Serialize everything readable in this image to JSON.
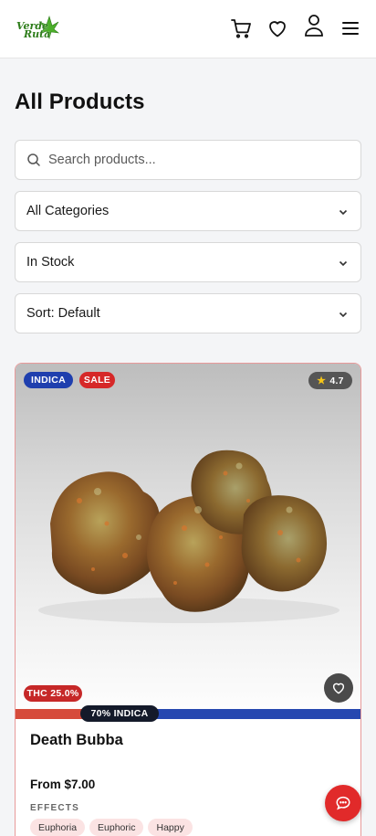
{
  "header": {
    "logo_text_line1": "Verde",
    "logo_text_line2": "Ruta",
    "icons": [
      "cart-icon",
      "heart-icon",
      "user-icon",
      "menu-icon"
    ]
  },
  "page_title": "All Products",
  "filters": {
    "search_placeholder": "Search products...",
    "category": "All Categories",
    "stock": "In Stock",
    "sort": "Sort: Default"
  },
  "product": {
    "strain_badge": "INDICA",
    "sale_badge": "SALE",
    "rating": "4.7",
    "thc_badge": "THC 25.0%",
    "ratio_label": "70% INDICA",
    "indica_fraction": 0.7,
    "name": "Death Bubba",
    "price": "From $7.00",
    "effects_label": "EFFECTS",
    "effects": [
      "Euphoria",
      "Euphoric",
      "Happy"
    ]
  },
  "colors": {
    "accent_red": "#d62828",
    "indica_blue": "#1f3fae",
    "logo_green": "#2e7d1b"
  }
}
